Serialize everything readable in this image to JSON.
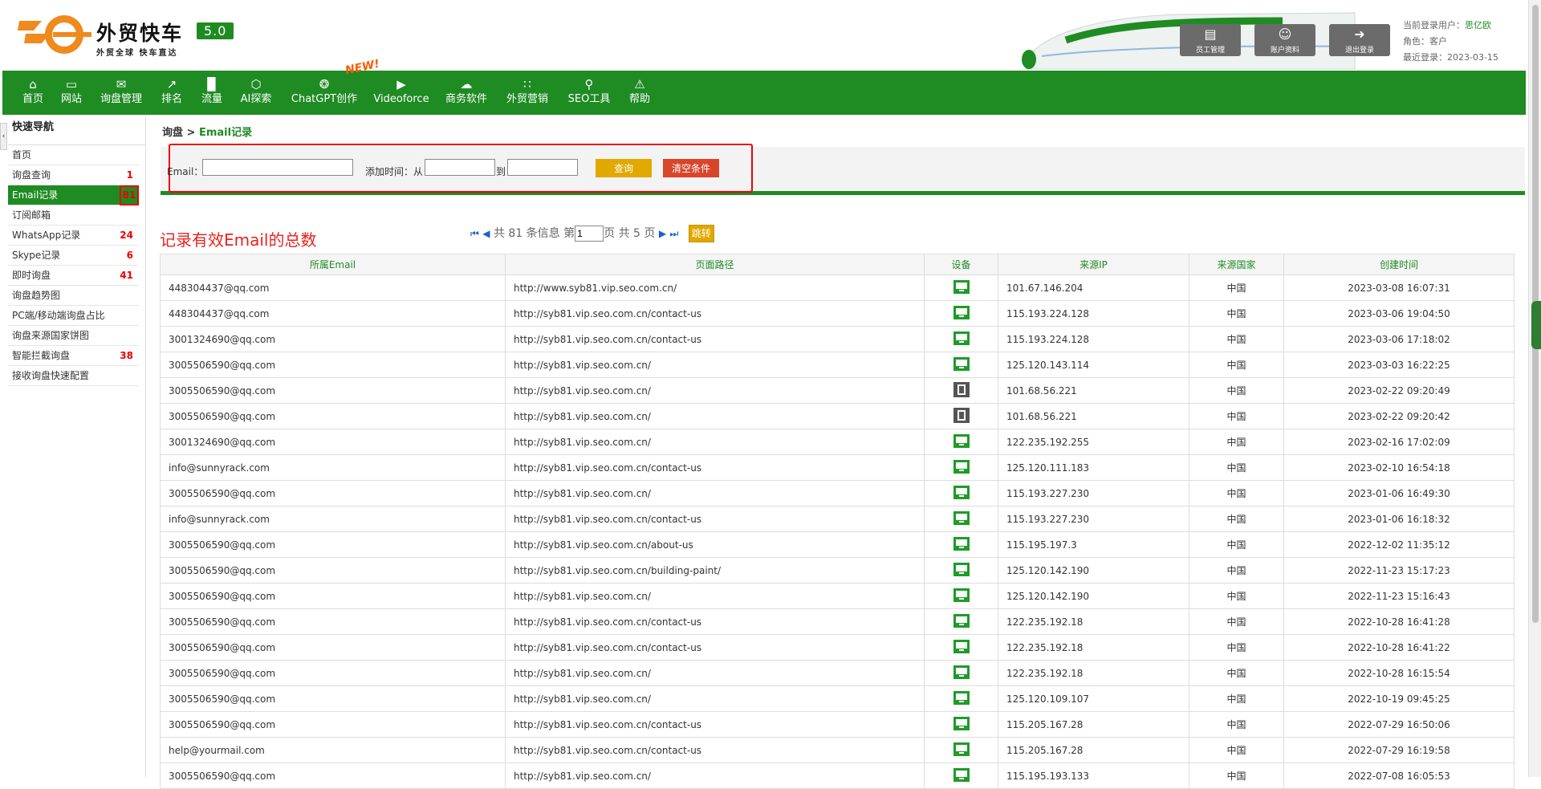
{
  "brand": {
    "name": "外贸快车",
    "version": "5.0",
    "slogan": "外贸全球 快车直达"
  },
  "header_buttons": [
    {
      "label": "员工管理",
      "icon": "staff-icon"
    },
    {
      "label": "账户资料",
      "icon": "account-icon"
    },
    {
      "label": "退出登录",
      "icon": "logout-icon"
    }
  ],
  "user": {
    "current_label": "当前登录用户：",
    "current": "思亿欧",
    "role": "角色：客户",
    "last_login": "最近登录：2023-03-15"
  },
  "nav": [
    {
      "label": "首页",
      "icon": "home-icon"
    },
    {
      "label": "网站",
      "icon": "monitor-icon"
    },
    {
      "label": "询盘管理",
      "icon": "mail-icon"
    },
    {
      "label": "排名",
      "icon": "ranking-icon"
    },
    {
      "label": "流量",
      "icon": "bar-chart-icon"
    },
    {
      "label": "AI探索",
      "icon": "ai-icon"
    },
    {
      "label": "ChatGPT创作",
      "icon": "chatgpt-icon"
    },
    {
      "label": "Videoforce",
      "icon": "play-icon"
    },
    {
      "label": "商务软件",
      "icon": "software-icon"
    },
    {
      "label": "外贸营销",
      "icon": "grid-icon"
    },
    {
      "label": "SEO工具",
      "icon": "search-icon"
    },
    {
      "label": "帮助",
      "icon": "warning-icon"
    }
  ],
  "new_badge": "NEW!",
  "sidebar": {
    "title": "快速导航",
    "items": [
      {
        "label": "首页",
        "count": ""
      },
      {
        "label": "询盘查询",
        "count": "1"
      },
      {
        "label": "Email记录",
        "count": "81"
      },
      {
        "label": "订阅邮箱",
        "count": ""
      },
      {
        "label": "WhatsApp记录",
        "count": "24"
      },
      {
        "label": "Skype记录",
        "count": "6"
      },
      {
        "label": "即时询盘",
        "count": "41"
      },
      {
        "label": "询盘趋势图",
        "count": ""
      },
      {
        "label": "PC端/移动端询盘占比",
        "count": ""
      },
      {
        "label": "询盘来源国家饼图",
        "count": ""
      },
      {
        "label": "智能拦截询盘",
        "count": "38"
      },
      {
        "label": "接收询盘快速配置",
        "count": ""
      }
    ]
  },
  "breadcrumb": {
    "parent": "询盘 > ",
    "current": "Email记录"
  },
  "filter": {
    "email_label": "Email：",
    "email_value": "",
    "time_label": "添加时间：从",
    "from_value": "",
    "to_label": "到",
    "to_value": "",
    "query_button": "查询",
    "clear_button": "清空条件"
  },
  "title_note": "记录有效Email的总数",
  "pager": {
    "total_text": "共 81 条信息 第",
    "page_value": "1",
    "pages_text": "页 共 5 页",
    "jump_button": "跳转"
  },
  "table": {
    "headers": [
      "所属Email",
      "页面路径",
      "设备",
      "来源IP",
      "来源国家",
      "创建时间"
    ],
    "rows": [
      [
        "448304437@qq.com",
        "http://www.syb81.vip.seo.com.cn/",
        "pc",
        "101.67.146.204",
        "中国",
        "2023-03-08 16:07:31"
      ],
      [
        "448304437@qq.com",
        "http://syb81.vip.seo.com.cn/contact-us",
        "pc",
        "115.193.224.128",
        "中国",
        "2023-03-06 19:04:50"
      ],
      [
        "3001324690@qq.com",
        "http://syb81.vip.seo.com.cn/contact-us",
        "pc",
        "115.193.224.128",
        "中国",
        "2023-03-06 17:18:02"
      ],
      [
        "3005506590@qq.com",
        "http://syb81.vip.seo.com.cn/",
        "pc",
        "125.120.143.114",
        "中国",
        "2023-03-03 16:22:25"
      ],
      [
        "3005506590@qq.com",
        "http://syb81.vip.seo.com.cn/",
        "mobile",
        "101.68.56.221",
        "中国",
        "2023-02-22 09:20:49"
      ],
      [
        "3005506590@qq.com",
        "http://syb81.vip.seo.com.cn/",
        "mobile",
        "101.68.56.221",
        "中国",
        "2023-02-22 09:20:42"
      ],
      [
        "3001324690@qq.com",
        "http://syb81.vip.seo.com.cn/",
        "pc",
        "122.235.192.255",
        "中国",
        "2023-02-16 17:02:09"
      ],
      [
        "info@sunnyrack.com",
        "http://syb81.vip.seo.com.cn/contact-us",
        "pc",
        "125.120.111.183",
        "中国",
        "2023-02-10 16:54:18"
      ],
      [
        "3005506590@qq.com",
        "http://syb81.vip.seo.com.cn/",
        "pc",
        "115.193.227.230",
        "中国",
        "2023-01-06 16:49:30"
      ],
      [
        "info@sunnyrack.com",
        "http://syb81.vip.seo.com.cn/contact-us",
        "pc",
        "115.193.227.230",
        "中国",
        "2023-01-06 16:18:32"
      ],
      [
        "3005506590@qq.com",
        "http://syb81.vip.seo.com.cn/about-us",
        "pc",
        "115.195.197.3",
        "中国",
        "2022-12-02 11:35:12"
      ],
      [
        "3005506590@qq.com",
        "http://syb81.vip.seo.com.cn/building-paint/",
        "pc",
        "125.120.142.190",
        "中国",
        "2022-11-23 15:17:23"
      ],
      [
        "3005506590@qq.com",
        "http://syb81.vip.seo.com.cn/",
        "pc",
        "125.120.142.190",
        "中国",
        "2022-11-23 15:16:43"
      ],
      [
        "3005506590@qq.com",
        "http://syb81.vip.seo.com.cn/contact-us",
        "pc",
        "122.235.192.18",
        "中国",
        "2022-10-28 16:41:28"
      ],
      [
        "3005506590@qq.com",
        "http://syb81.vip.seo.com.cn/contact-us",
        "pc",
        "122.235.192.18",
        "中国",
        "2022-10-28 16:41:22"
      ],
      [
        "3005506590@qq.com",
        "http://syb81.vip.seo.com.cn/",
        "pc",
        "122.235.192.18",
        "中国",
        "2022-10-28 16:15:54"
      ],
      [
        "3005506590@qq.com",
        "http://syb81.vip.seo.com.cn/",
        "pc",
        "125.120.109.107",
        "中国",
        "2022-10-19 09:45:25"
      ],
      [
        "3005506590@qq.com",
        "http://syb81.vip.seo.com.cn/contact-us",
        "pc",
        "115.205.167.28",
        "中国",
        "2022-07-29 16:50:06"
      ],
      [
        "help@yourmail.com",
        "http://syb81.vip.seo.com.cn/contact-us",
        "pc",
        "115.205.167.28",
        "中国",
        "2022-07-29 16:19:58"
      ],
      [
        "3005506590@qq.com",
        "http://syb81.vip.seo.com.cn/",
        "pc",
        "115.195.193.133",
        "中国",
        "2022-07-08 16:05:53"
      ]
    ]
  },
  "colors": {
    "brand_green": "#1f8b23",
    "accent_red": "#e8231f",
    "button_yellow": "#e0a800",
    "button_red": "#d9452b"
  }
}
